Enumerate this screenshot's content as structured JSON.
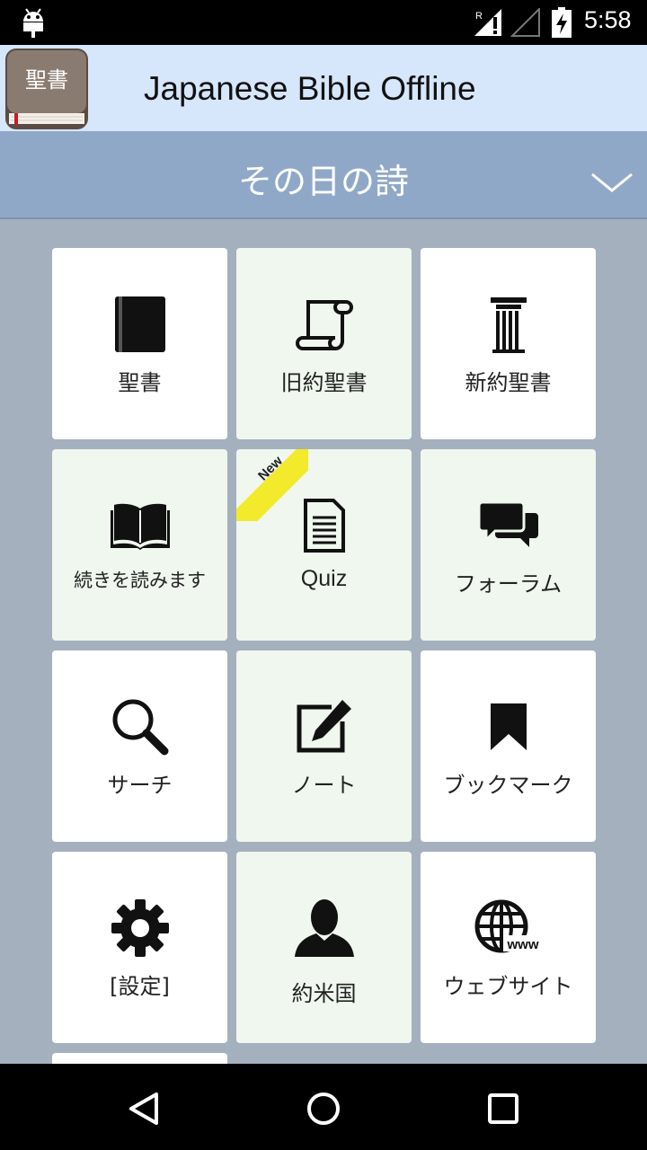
{
  "status_bar": {
    "time": "5:58",
    "icons": [
      "android-icon",
      "signal-roaming-icon",
      "signal-empty-icon",
      "battery-charging-icon"
    ]
  },
  "app_bar": {
    "logo_text": "聖書",
    "title": "Japanese Bible Offline"
  },
  "verse_header": {
    "title": "その日の詩",
    "toggle_icon": "chevron-down-icon"
  },
  "menu": [
    {
      "label": "聖書",
      "icon": "book-icon",
      "bg": "#ffffff"
    },
    {
      "label": "旧約聖書",
      "icon": "scroll-icon",
      "bg": "#eff7ee"
    },
    {
      "label": "新約聖書",
      "icon": "column-icon",
      "bg": "#ffffff"
    },
    {
      "label": "続きを読みます",
      "icon": "open-book-icon",
      "bg": "#eff7ee"
    },
    {
      "label": "Quiz",
      "icon": "document-icon",
      "bg": "#eff7ee",
      "badge": "New"
    },
    {
      "label": "フォーラム",
      "icon": "chat-icon",
      "bg": "#eff7ee"
    },
    {
      "label": "サーチ",
      "icon": "search-icon",
      "bg": "#ffffff"
    },
    {
      "label": "ノート",
      "icon": "edit-note-icon",
      "bg": "#eff7ee"
    },
    {
      "label": "ブックマーク",
      "icon": "bookmark-icon",
      "bg": "#ffffff"
    },
    {
      "label": "[設定]",
      "icon": "gear-icon",
      "bg": "#ffffff"
    },
    {
      "label": "約米国",
      "icon": "person-icon",
      "bg": "#eff7ee"
    },
    {
      "label": "ウェブサイト",
      "icon": "globe-www-icon",
      "bg": "#ffffff"
    }
  ],
  "nav_bar": {
    "buttons": [
      "back-icon",
      "home-icon",
      "recents-icon"
    ]
  }
}
